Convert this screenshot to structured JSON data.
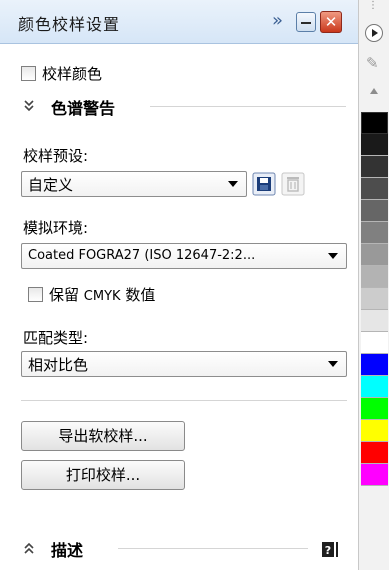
{
  "docker": {
    "title": "颜色校样设置",
    "more_label": "»",
    "close_label": "✕",
    "checkbox_proof_colors": "校样颜色",
    "section_gamut": "色谱警告",
    "proof_preset_label": "校样预设:",
    "proof_preset_value": "自定义",
    "sim_env_label": "模拟环境:",
    "sim_env_value": "Coated FOGRA27 (ISO 12647-2:2...",
    "preserve_cmyk_prefix": "保留",
    "preserve_cmyk_mid": "CMYK",
    "preserve_cmyk_suffix": "数值",
    "match_type_label": "匹配类型:",
    "match_type_value": "相对比色",
    "export_button": "导出软校样...",
    "print_button": "打印校样...",
    "section_desc": "描述"
  },
  "palette": {
    "swatches": [
      "#000000",
      "#1a1a1a",
      "#333333",
      "#4d4d4d",
      "#666666",
      "#808080",
      "#999999",
      "#b3b3b3",
      "#cccccc",
      "#e6e6e6",
      "#ffffff",
      "#0000ff",
      "#00ffff",
      "#00ff00",
      "#ffff00",
      "#ff0000",
      "#ff00ff"
    ]
  }
}
